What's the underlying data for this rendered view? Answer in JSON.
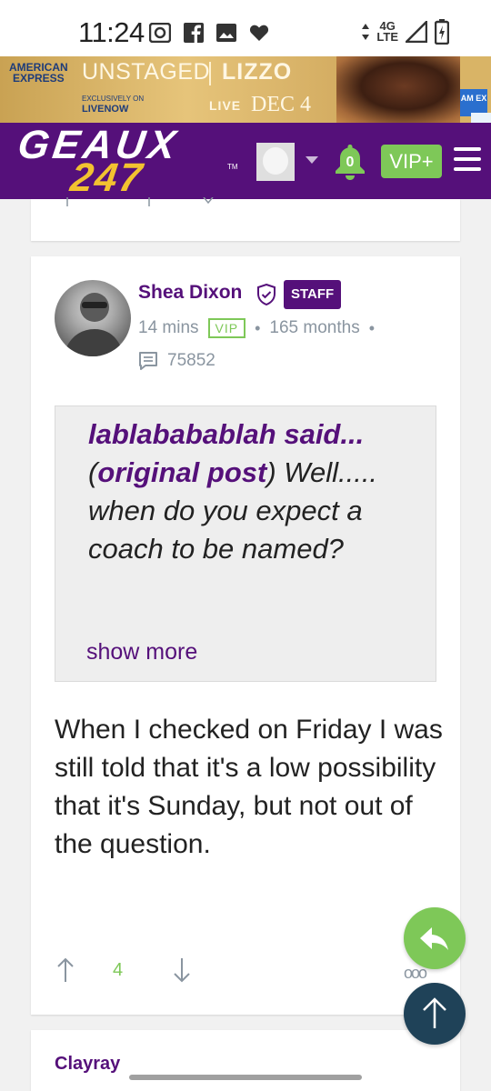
{
  "status_bar": {
    "time": "11:24",
    "network": "4G\nLTE"
  },
  "ad": {
    "amex_top": "AMERICAN",
    "amex_bottom": "EXPRESS",
    "unstaged": "UNSTAGED",
    "lizzo": "LIZZO",
    "exclusively": "EXCLUSIVELY ON",
    "livenow": "LIVENOW",
    "live": "LIVE",
    "date": "DEC 4",
    "amex_badge": "AM EX"
  },
  "header": {
    "logo_top": "GEAUX",
    "logo_bottom": "247",
    "notification_count": "0",
    "vip_label": "VIP+"
  },
  "post": {
    "author": "Shea Dixon",
    "badge": "STAFF",
    "time_ago": "14 mins",
    "vip_tag": "VIP",
    "membership": "165 months",
    "post_count": "75852",
    "quote_author": "lablababablah said...",
    "quote_link": "original post",
    "quote_body": " Well..... when do you expect a coach to be named?",
    "show_more": "show more",
    "body": "When I checked on Friday I was still told that it's a low possibility that it's Sunday, but not out of the question.",
    "votes": "4"
  },
  "next_post": {
    "author": "Clayray"
  },
  "colors": {
    "brand_purple": "#55107a",
    "accent_green": "#7ec858",
    "gold": "#f2c230",
    "scroll_top_navy": "#1f4258"
  }
}
